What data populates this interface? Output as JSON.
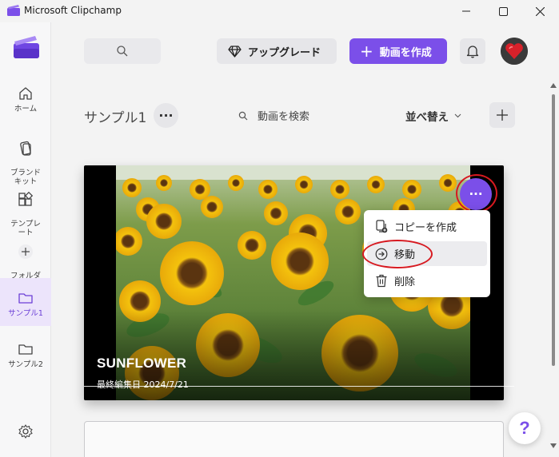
{
  "window": {
    "title": "Microsoft Clipchamp"
  },
  "sidebar": {
    "items": [
      {
        "label": "ホーム",
        "icon": "home-icon"
      },
      {
        "label": "ブランド\nキット",
        "icon": "brand-kit-icon"
      },
      {
        "label": "テンプレ\nート",
        "icon": "templates-icon"
      },
      {
        "label": "フォルダ\nーの追加",
        "icon": "add-folder-icon"
      },
      {
        "label": "サンプル1",
        "icon": "folder-icon",
        "active": true
      },
      {
        "label": "サンプル2",
        "icon": "folder-icon"
      }
    ]
  },
  "header": {
    "search_icon": "search-icon",
    "upgrade_label": "アップグレード",
    "create_label": "動画を作成",
    "bell_icon": "bell-icon"
  },
  "folder": {
    "title": "サンプル1",
    "more_label": "···",
    "search_placeholder": "動画を検索",
    "sort_label": "並べ替え",
    "add_label": "+"
  },
  "video": {
    "title": "SUNFLOWER",
    "edited": "最終編集日 2024/7/21",
    "more_label": "···"
  },
  "context_menu": {
    "items": [
      {
        "label": "コピーを作成",
        "icon": "copy-icon"
      },
      {
        "label": "移動",
        "icon": "move-icon"
      },
      {
        "label": "削除",
        "icon": "trash-icon"
      }
    ]
  },
  "help_label": "?",
  "colors": {
    "accent": "#7b4fe9",
    "annotation_red": "#d71920"
  }
}
